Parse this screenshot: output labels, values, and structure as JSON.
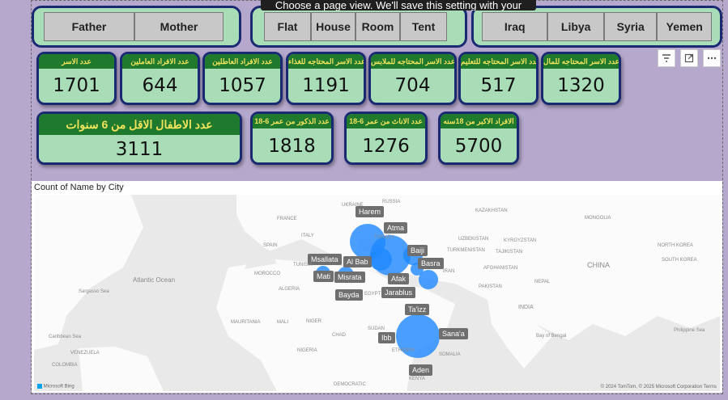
{
  "tooltip": "Choose a page view. We'll save this setting with your report.",
  "slicer_family": [
    "Father",
    "Mother"
  ],
  "slicer_housing": [
    "Flat",
    "House",
    "Room",
    "Tent"
  ],
  "slicer_country": [
    "Iraq",
    "Libya",
    "Syria",
    "Yemen"
  ],
  "cards_row1": [
    {
      "label": "عدد الاسر",
      "value": "1701"
    },
    {
      "label": "عدد الافراد العاملين",
      "value": "644"
    },
    {
      "label": "عدد الافراد العاطلين",
      "value": "1057"
    },
    {
      "label": "عدد الاسر المحتاجه للغذاء",
      "value": "1191"
    },
    {
      "label": "عدد الاسر المحتاجه للملابس",
      "value": "704"
    },
    {
      "label": "عدد الاسر المحتاجه للتعليم",
      "value": "517"
    },
    {
      "label": "عدد الاسر المحتاجه للمال",
      "value": "1320"
    }
  ],
  "card_children": {
    "label": "عدد الاطفال الاقل من 6 سنوات",
    "value": "3111"
  },
  "cards_row2": [
    {
      "label": "عدد الذكور من عمر 6-18",
      "value": "1818"
    },
    {
      "label": "عدد الاناث من عمر 6-18",
      "value": "1276"
    },
    {
      "label": "الافراد الاكبر من 18سنه",
      "value": "5700"
    }
  ],
  "visual_icons": [
    "filter-icon",
    "focus-mode-icon",
    "more-options-icon"
  ],
  "map_visual": {
    "title": "Count of Name by City",
    "cities": [
      "Harem",
      "Atma",
      "Baiji",
      "Basra",
      "Msallata",
      "Al Bab",
      "Mati",
      "Misrata",
      "Afak",
      "Jarablus",
      "Bayda",
      "Ta'izz",
      "Sana'a",
      "Ibb",
      "Aden"
    ],
    "geo_labels": [
      "FRANCE",
      "UKRAINE",
      "RUSSIA",
      "KAZAKHSTAN",
      "MONGOLIA",
      "SPAIN",
      "ITALY",
      "TURKEY",
      "UZBEKISTAN",
      "KYRGYZSTAN",
      "TURKMENISTAN",
      "TAJIKISTAN",
      "NORTH KOREA",
      "SOUTH KOREA",
      "MOROCCO",
      "TUNISIA",
      "IRAN",
      "AFGHANISTAN",
      "CHINA",
      "Atlantic Ocean",
      "ALGERIA",
      "EGYPT",
      "PAKISTAN",
      "NEPAL",
      "Sargasso Sea",
      "MAURITANIA",
      "MALI",
      "NIGER",
      "CHAD",
      "SUDAN",
      "INDIA",
      "Caribbean Sea",
      "VENEZUELA",
      "COLOMBIA",
      "NIGERIA",
      "ETHIOPIA",
      "Bay of Bengal",
      "Philippine Sea",
      "SOMALIA",
      "KENYA",
      "DEMOCRATIC"
    ],
    "footer_left": "Microsoft Bing",
    "footer_right": "© 2024 TomTom, © 2025 Microsoft Corporation  Terms"
  },
  "colors": {
    "card_bg": "#a8ddb7",
    "border": "#1a2a72",
    "header": "#1f7a2e",
    "header_text": "#f2e35c",
    "bubble": "#1e88ff",
    "page_bg": "#b6a8cc"
  }
}
